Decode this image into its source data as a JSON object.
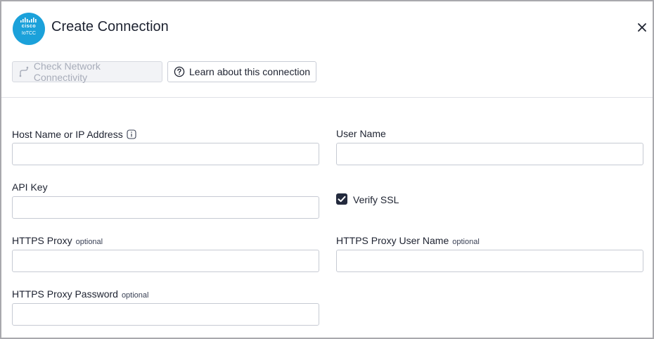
{
  "header": {
    "logo_word": "cisco",
    "logo_sub": "IoTCC",
    "title": "Create Connection"
  },
  "toolbar": {
    "check_connectivity_label": "Check Network Connectivity",
    "learn_label": "Learn about this connection"
  },
  "form": {
    "host": {
      "label": "Host Name or IP Address",
      "value": ""
    },
    "user_name": {
      "label": "User Name",
      "value": ""
    },
    "api_key": {
      "label": "API Key",
      "value": ""
    },
    "verify_ssl": {
      "label": "Verify SSL",
      "checked": true
    },
    "https_proxy": {
      "label": "HTTPS Proxy",
      "optional": "optional",
      "value": ""
    },
    "https_proxy_user": {
      "label": "HTTPS Proxy User Name",
      "optional": "optional",
      "value": ""
    },
    "https_proxy_password": {
      "label": "HTTPS Proxy Password",
      "optional": "optional",
      "value": ""
    }
  },
  "colors": {
    "logo": "#1ba1da",
    "checkbox": "#232a3d"
  }
}
